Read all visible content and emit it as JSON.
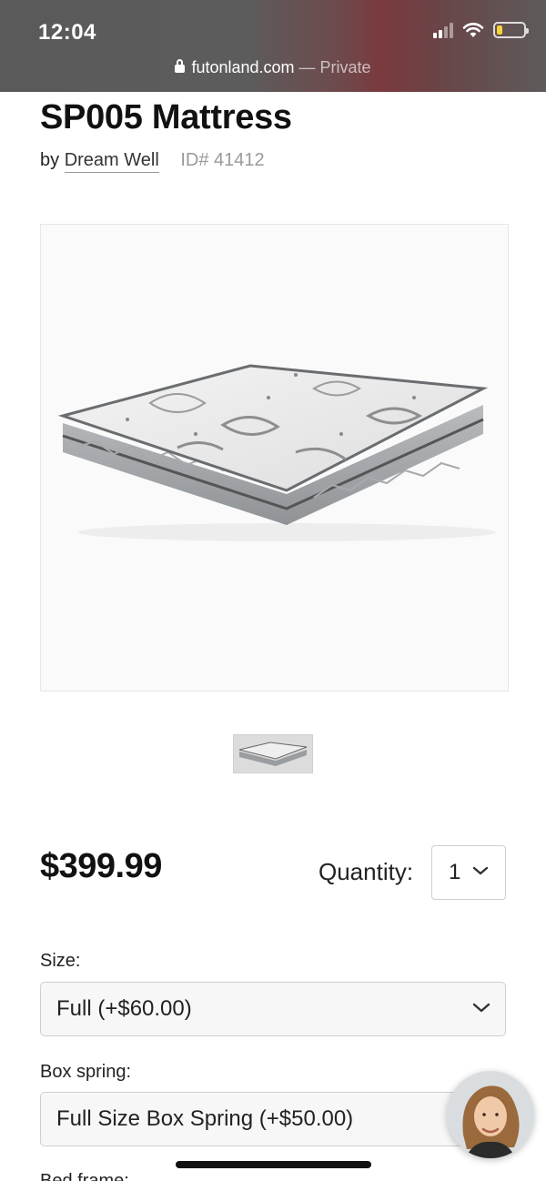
{
  "status_bar": {
    "time": "12:04",
    "battery_level": 0.2,
    "battery_color": "#f5d33a"
  },
  "url_bar": {
    "domain": "futonland.com",
    "mode": "— Private"
  },
  "product": {
    "title": "SP005 Mattress",
    "by_label": "by",
    "brand": "Dream Well",
    "id_label": "ID# 41412",
    "price": "$399.99",
    "main_image_icon": "mattress-image",
    "thumbnail_icon": "mattress-thumbnail"
  },
  "quantity": {
    "label": "Quantity:",
    "value": "1"
  },
  "options": {
    "size": {
      "label": "Size:",
      "value": "Full (+$60.00)"
    },
    "box_spring": {
      "label": "Box spring:",
      "value": "Full Size Box Spring (+$50.00)"
    },
    "bed_frame": {
      "label": "Bed frame:"
    }
  },
  "chat": {
    "icon": "support-avatar"
  }
}
